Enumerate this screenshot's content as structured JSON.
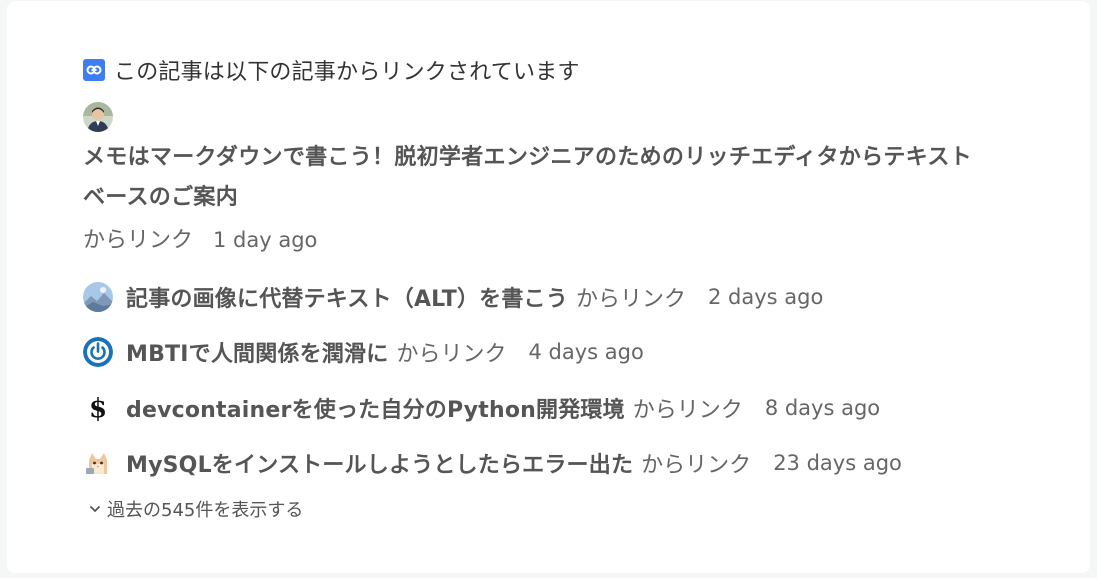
{
  "header": {
    "icon": "link-icon",
    "title": "この記事は以下の記事からリンクされています"
  },
  "first": {
    "avatar": "user-avatar-photo",
    "title": "メモはマークダウンで書こう！脱初学者エンジニアのためのリッチエディタからテキストベースのご案内",
    "suffix": "からリンク",
    "time": "1 day ago"
  },
  "items": [
    {
      "avatar": "landscape-avatar",
      "title": "記事の画像に代替テキスト（ALT）を書こう",
      "suffix": "からリンク",
      "time": "2 days ago"
    },
    {
      "avatar": "power-icon-avatar",
      "title": "MBTIで人間関係を潤滑に",
      "suffix": "からリンク",
      "time": "4 days ago"
    },
    {
      "avatar": "dollar-icon-avatar",
      "title": "devcontainerを使った自分のPython開発環境",
      "suffix": "からリンク",
      "time": "8 days ago"
    },
    {
      "avatar": "cat-avatar",
      "title": "MySQLをインストールしようとしたらエラー出た",
      "suffix": "からリンク",
      "time": "23 days ago"
    }
  ],
  "more": {
    "icon": "chevron-down-icon",
    "label": "過去の545件を表示する"
  },
  "colors": {
    "link_icon_bg": "#3d7ef0",
    "power_icon": "#1a72b8"
  }
}
